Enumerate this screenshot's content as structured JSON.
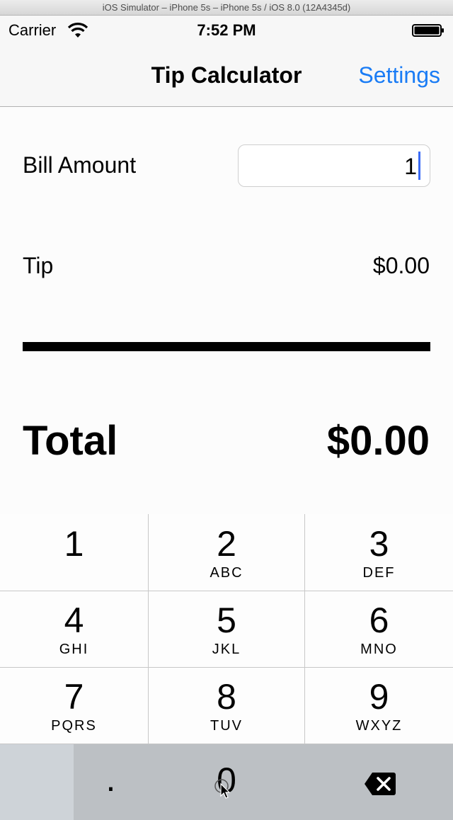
{
  "simulator": {
    "title": "iOS Simulator – iPhone 5s – iPhone 5s / iOS 8.0 (12A4345d)"
  },
  "status_bar": {
    "carrier": "Carrier",
    "time": "7:52 PM"
  },
  "nav": {
    "title": "Tip Calculator",
    "settings_label": "Settings"
  },
  "form": {
    "bill_label": "Bill Amount",
    "bill_value": "1",
    "tip_label": "Tip",
    "tip_value": "$0.00",
    "total_label": "Total",
    "total_value": "$0.00"
  },
  "keypad": {
    "keys": [
      {
        "digit": "1",
        "letters": ""
      },
      {
        "digit": "2",
        "letters": "ABC"
      },
      {
        "digit": "3",
        "letters": "DEF"
      },
      {
        "digit": "4",
        "letters": "GHI"
      },
      {
        "digit": "5",
        "letters": "JKL"
      },
      {
        "digit": "6",
        "letters": "MNO"
      },
      {
        "digit": "7",
        "letters": "PQRS"
      },
      {
        "digit": "8",
        "letters": "TUV"
      },
      {
        "digit": "9",
        "letters": "WXYZ"
      }
    ],
    "dot_label": ".",
    "zero_label": "0"
  },
  "colors": {
    "accent": "#1a7cf5",
    "caret": "#3b6cf6",
    "keypad_background": "#fdfdfd",
    "bottom_row": "#bcc0c4"
  },
  "icons": {
    "wifi": "wifi-icon",
    "battery": "battery-icon",
    "delete": "delete-backspace-icon",
    "cursor": "mouse-cursor-icon"
  }
}
